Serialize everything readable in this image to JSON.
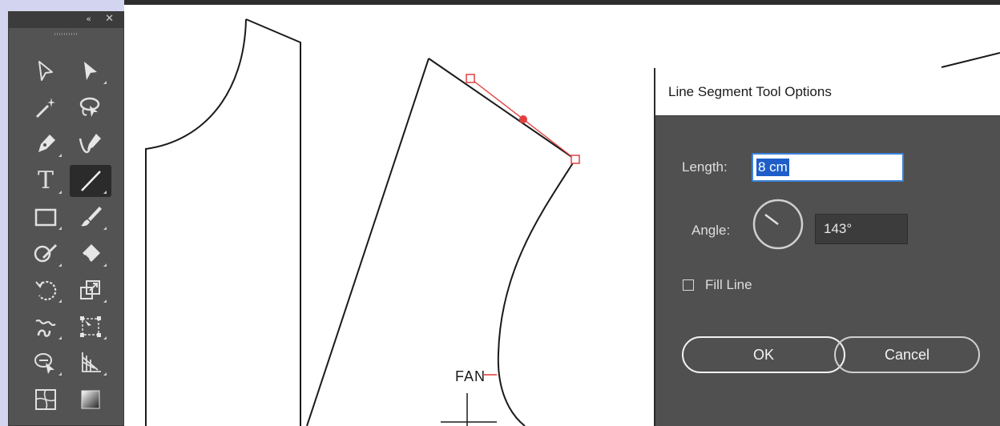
{
  "tools_panel": {
    "collapse_label": "«",
    "close_label": "✕",
    "type_tool_glyph": "T",
    "icons": [
      "selection-tool-icon",
      "direct-selection-tool-icon",
      "magic-wand-tool-icon",
      "lasso-tool-icon",
      "pen-tool-icon",
      "curvature-tool-icon",
      "type-tool-icon",
      "line-segment-tool-icon",
      "rectangle-tool-icon",
      "paintbrush-tool-icon",
      "shaper-tool-icon",
      "eraser-tool-icon",
      "rotate-tool-icon",
      "scale-tool-icon",
      "warp-tool-icon",
      "free-transform-tool-icon",
      "shape-builder-tool-icon",
      "perspective-grid-tool-icon",
      "mesh-tool-icon",
      "gradient-tool-icon"
    ],
    "active_tool": "line-segment-tool"
  },
  "canvas": {
    "annotation_label": "FAN",
    "accent_color": "#e04040"
  },
  "dialog": {
    "title": "Line Segment Tool Options",
    "length_label": "Length:",
    "length_value": "8 cm",
    "angle_label": "Angle:",
    "angle_value": "143°",
    "angle_degrees": 143,
    "fill_line_label": "Fill Line",
    "fill_line_checked": false,
    "ok_label": "OK",
    "cancel_label": "Cancel"
  }
}
